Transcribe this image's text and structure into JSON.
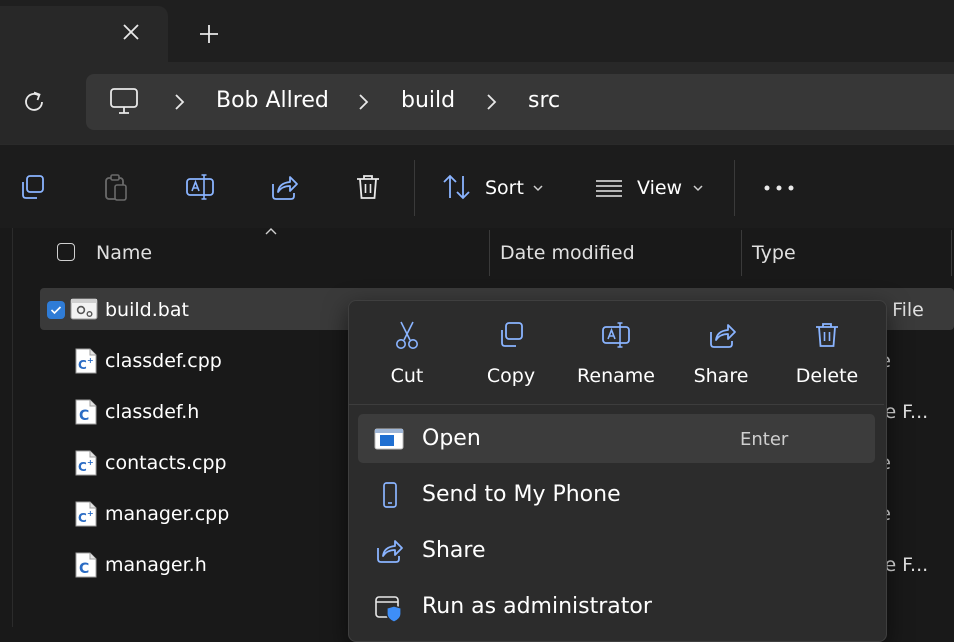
{
  "tab": {
    "close_icon": "close-icon",
    "new_tab_icon": "plus-icon"
  },
  "breadcrumb": {
    "root_icon": "this-pc-icon",
    "items": [
      "Bob Allred",
      "build",
      "src"
    ]
  },
  "commandbar": {
    "copy_icon": "copy-icon",
    "paste_icon": "paste-icon",
    "rename_icon": "rename-icon",
    "share_icon": "share-icon",
    "delete_icon": "delete-icon",
    "sort_label": "Sort",
    "view_label": "View",
    "more_icon": "more-icon"
  },
  "columns": [
    "Name",
    "Date modified",
    "Type"
  ],
  "files": [
    {
      "name": "build.bat",
      "icon": "batch-file-icon",
      "selected": true,
      "type_fragment": "h File"
    },
    {
      "name": "classdef.cpp",
      "icon": "cpp-file-icon",
      "selected": false,
      "type_fragment": "le"
    },
    {
      "name": "classdef.h",
      "icon": "c-header-file-icon",
      "selected": false,
      "type_fragment": "ce F..."
    },
    {
      "name": "contacts.cpp",
      "icon": "cpp-file-icon",
      "selected": false,
      "type_fragment": "le"
    },
    {
      "name": "manager.cpp",
      "icon": "cpp-file-icon",
      "selected": false,
      "type_fragment": "le"
    },
    {
      "name": "manager.h",
      "icon": "c-header-file-icon",
      "selected": false,
      "type_fragment": "ce F..."
    }
  ],
  "context_menu": {
    "top_actions": [
      "Cut",
      "Copy",
      "Rename",
      "Share",
      "Delete"
    ],
    "items": [
      {
        "label": "Open",
        "shortcut": "Enter",
        "icon": "open-icon"
      },
      {
        "label": "Send to My Phone",
        "shortcut": "",
        "icon": "phone-icon"
      },
      {
        "label": "Share",
        "shortcut": "",
        "icon": "share-icon"
      },
      {
        "label": "Run as administrator",
        "shortcut": "",
        "icon": "admin-shield-icon"
      }
    ]
  },
  "colors": {
    "accent": "#60cdff",
    "check": "#2f7cd6",
    "icon_blue": "#8ab4ff"
  }
}
